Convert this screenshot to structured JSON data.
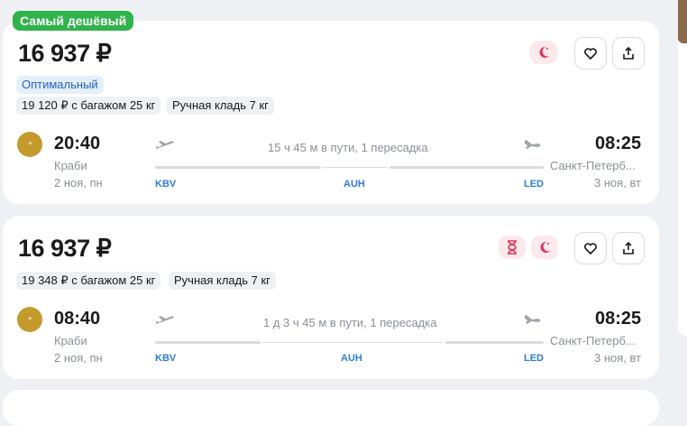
{
  "badge": "Самый дешёвый",
  "cards": [
    {
      "price": "16 937 ₽",
      "tariff": "Оптимальный",
      "baggage": "19 120 ₽ с багажом 25 кг",
      "hand_luggage": "Ручная кладь 7 кг",
      "dep_time": "20:40",
      "dep_city": "Краби",
      "dep_date": "2 ноя, пн",
      "arr_time": "08:25",
      "arr_city": "Санкт-Петерб...",
      "arr_date": "3 ноя, вт",
      "duration": "15 ч 45 м в пути, 1 пересадка",
      "from_code": "KBV",
      "via_code": "AUH",
      "to_code": "LED",
      "tags": [
        "night-flight"
      ]
    },
    {
      "price": "16 937 ₽",
      "baggage": "19 348 ₽ с багажом 25 кг",
      "hand_luggage": "Ручная кладь 7 кг",
      "dep_time": "08:40",
      "dep_city": "Краби",
      "dep_date": "2 ноя, пн",
      "arr_time": "08:25",
      "arr_city": "Санкт-Петерб...",
      "arr_date": "3 ноя, вт",
      "duration": "1 д 3 ч 45 м в пути, 1 пересадка",
      "from_code": "KBV",
      "via_code": "AUH",
      "to_code": "LED",
      "tags": [
        "long-layover",
        "night-flight"
      ]
    }
  ],
  "colors": {
    "badge": "#2fb34a",
    "code": "#2e7bd6",
    "tag_bg": "#fde8ec",
    "tag_icon": "#e0335a"
  }
}
